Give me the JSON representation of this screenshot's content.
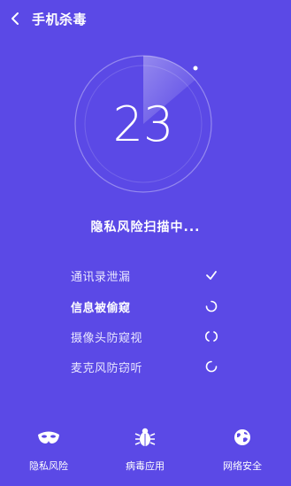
{
  "header": {
    "title": "手机杀毒"
  },
  "scan": {
    "count": "23",
    "status": "隐私风险扫描中..."
  },
  "checklist": [
    {
      "label": "通讯录泄漏",
      "state": "done",
      "bold": false
    },
    {
      "label": "信息被偷窥",
      "state": "loading",
      "bold": true
    },
    {
      "label": "摄像头防窥视",
      "state": "loading",
      "bold": false
    },
    {
      "label": "麦克风防窃听",
      "state": "loading",
      "bold": false
    }
  ],
  "tabs": [
    {
      "label": "隐私风险",
      "icon": "mask-icon"
    },
    {
      "label": "病毒应用",
      "icon": "bug-icon"
    },
    {
      "label": "网络安全",
      "icon": "globe-shield-icon"
    }
  ],
  "colors": {
    "background": "#5b49e6",
    "text": "#ffffff"
  }
}
